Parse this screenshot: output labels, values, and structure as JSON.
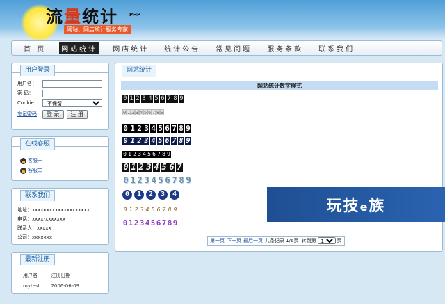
{
  "header": {
    "logo_char1": "流",
    "logo_char2": "量",
    "logo_char3": "统计",
    "logo_sup": "PHP",
    "tagline": "网站、网店统计服务专家"
  },
  "nav": {
    "items": [
      {
        "label": "首 页"
      },
      {
        "label": "网站统计"
      },
      {
        "label": "网店统计"
      },
      {
        "label": "统计公告"
      },
      {
        "label": "常见问题"
      },
      {
        "label": "服务条款"
      },
      {
        "label": "联系我们"
      }
    ],
    "active_index": 1
  },
  "login": {
    "title": "用户登录",
    "username_label": "用户名：",
    "password_label": "密 码：",
    "cookie_label": "Cookie：",
    "cookie_selected": "不保留",
    "forgot_label": "忘记密码",
    "login_button": "登 录",
    "register_button": "注 册"
  },
  "service": {
    "title": "在线客服",
    "items": [
      "客服一",
      "客服二"
    ]
  },
  "contact": {
    "title": "联系我们",
    "lines": [
      "地址：xxxxxxxxxxxxxxxxxxxx",
      "电话：xxxx-xxxxxxx",
      "联系人：xxxxx",
      "公司：xxxxxxx"
    ]
  },
  "latest": {
    "title": "最新注册",
    "col_user": "用户名",
    "col_date": "注册日期",
    "rows": [
      {
        "user": "mytest",
        "date": "2006-06-09"
      }
    ]
  },
  "main": {
    "tab_label": "网站统计",
    "section_title": "网站统计数字样式",
    "counter_digits": "0123456789",
    "counter_partial_6": "0123456",
    "counter_partial_7": "01234567",
    "counter_partial_4": "01234"
  },
  "pager": {
    "first": "第一页",
    "next": "下一页",
    "last": "最后一页",
    "summary": "共条记录 1/6页",
    "goto_label": "转到第",
    "page_value": "1",
    "page_suffix": "页"
  },
  "watermark": {
    "text": "玩技",
    "e": "e",
    "suffix": "族"
  }
}
